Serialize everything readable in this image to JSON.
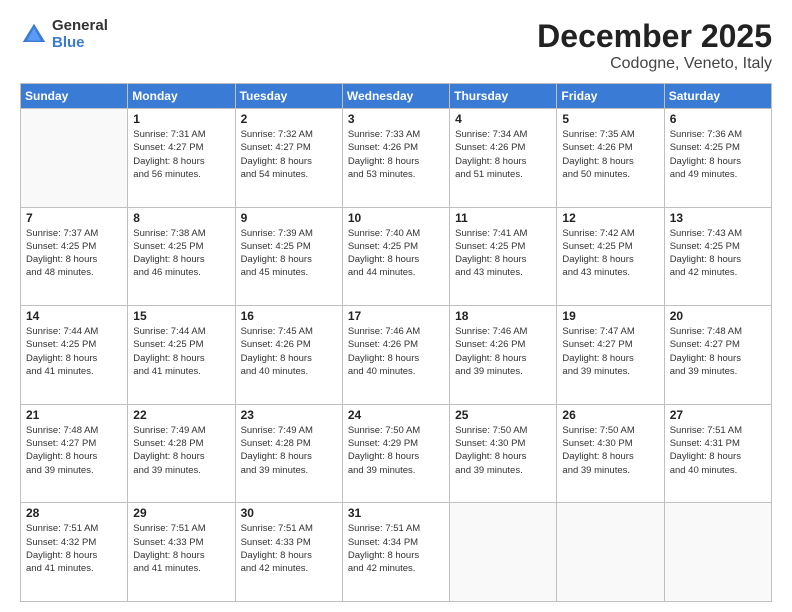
{
  "logo": {
    "general": "General",
    "blue": "Blue"
  },
  "header": {
    "month": "December 2025",
    "location": "Codogne, Veneto, Italy"
  },
  "weekdays": [
    "Sunday",
    "Monday",
    "Tuesday",
    "Wednesday",
    "Thursday",
    "Friday",
    "Saturday"
  ],
  "weeks": [
    [
      {
        "day": "",
        "info": ""
      },
      {
        "day": "1",
        "info": "Sunrise: 7:31 AM\nSunset: 4:27 PM\nDaylight: 8 hours\nand 56 minutes."
      },
      {
        "day": "2",
        "info": "Sunrise: 7:32 AM\nSunset: 4:27 PM\nDaylight: 8 hours\nand 54 minutes."
      },
      {
        "day": "3",
        "info": "Sunrise: 7:33 AM\nSunset: 4:26 PM\nDaylight: 8 hours\nand 53 minutes."
      },
      {
        "day": "4",
        "info": "Sunrise: 7:34 AM\nSunset: 4:26 PM\nDaylight: 8 hours\nand 51 minutes."
      },
      {
        "day": "5",
        "info": "Sunrise: 7:35 AM\nSunset: 4:26 PM\nDaylight: 8 hours\nand 50 minutes."
      },
      {
        "day": "6",
        "info": "Sunrise: 7:36 AM\nSunset: 4:25 PM\nDaylight: 8 hours\nand 49 minutes."
      }
    ],
    [
      {
        "day": "7",
        "info": "Sunrise: 7:37 AM\nSunset: 4:25 PM\nDaylight: 8 hours\nand 48 minutes."
      },
      {
        "day": "8",
        "info": "Sunrise: 7:38 AM\nSunset: 4:25 PM\nDaylight: 8 hours\nand 46 minutes."
      },
      {
        "day": "9",
        "info": "Sunrise: 7:39 AM\nSunset: 4:25 PM\nDaylight: 8 hours\nand 45 minutes."
      },
      {
        "day": "10",
        "info": "Sunrise: 7:40 AM\nSunset: 4:25 PM\nDaylight: 8 hours\nand 44 minutes."
      },
      {
        "day": "11",
        "info": "Sunrise: 7:41 AM\nSunset: 4:25 PM\nDaylight: 8 hours\nand 43 minutes."
      },
      {
        "day": "12",
        "info": "Sunrise: 7:42 AM\nSunset: 4:25 PM\nDaylight: 8 hours\nand 43 minutes."
      },
      {
        "day": "13",
        "info": "Sunrise: 7:43 AM\nSunset: 4:25 PM\nDaylight: 8 hours\nand 42 minutes."
      }
    ],
    [
      {
        "day": "14",
        "info": "Sunrise: 7:44 AM\nSunset: 4:25 PM\nDaylight: 8 hours\nand 41 minutes."
      },
      {
        "day": "15",
        "info": "Sunrise: 7:44 AM\nSunset: 4:25 PM\nDaylight: 8 hours\nand 41 minutes."
      },
      {
        "day": "16",
        "info": "Sunrise: 7:45 AM\nSunset: 4:26 PM\nDaylight: 8 hours\nand 40 minutes."
      },
      {
        "day": "17",
        "info": "Sunrise: 7:46 AM\nSunset: 4:26 PM\nDaylight: 8 hours\nand 40 minutes."
      },
      {
        "day": "18",
        "info": "Sunrise: 7:46 AM\nSunset: 4:26 PM\nDaylight: 8 hours\nand 39 minutes."
      },
      {
        "day": "19",
        "info": "Sunrise: 7:47 AM\nSunset: 4:27 PM\nDaylight: 8 hours\nand 39 minutes."
      },
      {
        "day": "20",
        "info": "Sunrise: 7:48 AM\nSunset: 4:27 PM\nDaylight: 8 hours\nand 39 minutes."
      }
    ],
    [
      {
        "day": "21",
        "info": "Sunrise: 7:48 AM\nSunset: 4:27 PM\nDaylight: 8 hours\nand 39 minutes."
      },
      {
        "day": "22",
        "info": "Sunrise: 7:49 AM\nSunset: 4:28 PM\nDaylight: 8 hours\nand 39 minutes."
      },
      {
        "day": "23",
        "info": "Sunrise: 7:49 AM\nSunset: 4:28 PM\nDaylight: 8 hours\nand 39 minutes."
      },
      {
        "day": "24",
        "info": "Sunrise: 7:50 AM\nSunset: 4:29 PM\nDaylight: 8 hours\nand 39 minutes."
      },
      {
        "day": "25",
        "info": "Sunrise: 7:50 AM\nSunset: 4:30 PM\nDaylight: 8 hours\nand 39 minutes."
      },
      {
        "day": "26",
        "info": "Sunrise: 7:50 AM\nSunset: 4:30 PM\nDaylight: 8 hours\nand 39 minutes."
      },
      {
        "day": "27",
        "info": "Sunrise: 7:51 AM\nSunset: 4:31 PM\nDaylight: 8 hours\nand 40 minutes."
      }
    ],
    [
      {
        "day": "28",
        "info": "Sunrise: 7:51 AM\nSunset: 4:32 PM\nDaylight: 8 hours\nand 41 minutes."
      },
      {
        "day": "29",
        "info": "Sunrise: 7:51 AM\nSunset: 4:33 PM\nDaylight: 8 hours\nand 41 minutes."
      },
      {
        "day": "30",
        "info": "Sunrise: 7:51 AM\nSunset: 4:33 PM\nDaylight: 8 hours\nand 42 minutes."
      },
      {
        "day": "31",
        "info": "Sunrise: 7:51 AM\nSunset: 4:34 PM\nDaylight: 8 hours\nand 42 minutes."
      },
      {
        "day": "",
        "info": ""
      },
      {
        "day": "",
        "info": ""
      },
      {
        "day": "",
        "info": ""
      }
    ]
  ]
}
